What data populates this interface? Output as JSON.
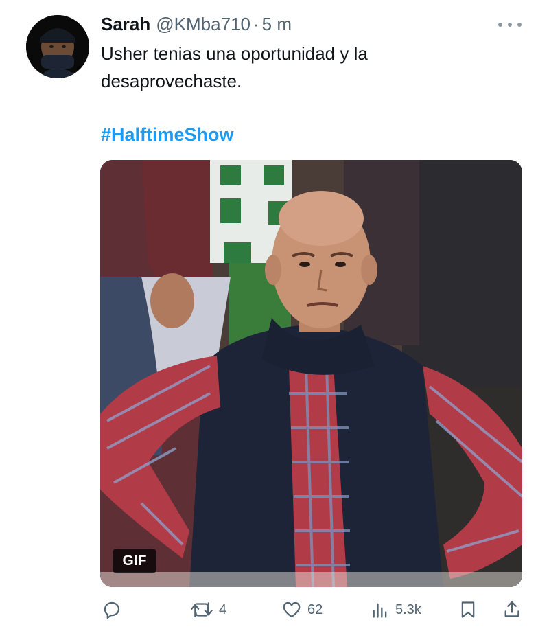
{
  "tweet": {
    "author_name": "Sarah",
    "handle": "@KMba710",
    "separator": "·",
    "time": "5 m",
    "text": "Usher tenias una oportunidad y la\ndesaprovechaste.",
    "hashtag": "#HalftimeShow"
  },
  "media": {
    "badge": "GIF"
  },
  "actions": {
    "reply_icon": "reply-icon",
    "retweet_count": "4",
    "like_count": "62",
    "views_count": "5.3k",
    "bookmark_icon": "bookmark-icon",
    "share_icon": "share-icon"
  },
  "colors": {
    "link": "#1d9bf0",
    "secondary_text": "#536471",
    "primary_text": "#0f1419"
  }
}
